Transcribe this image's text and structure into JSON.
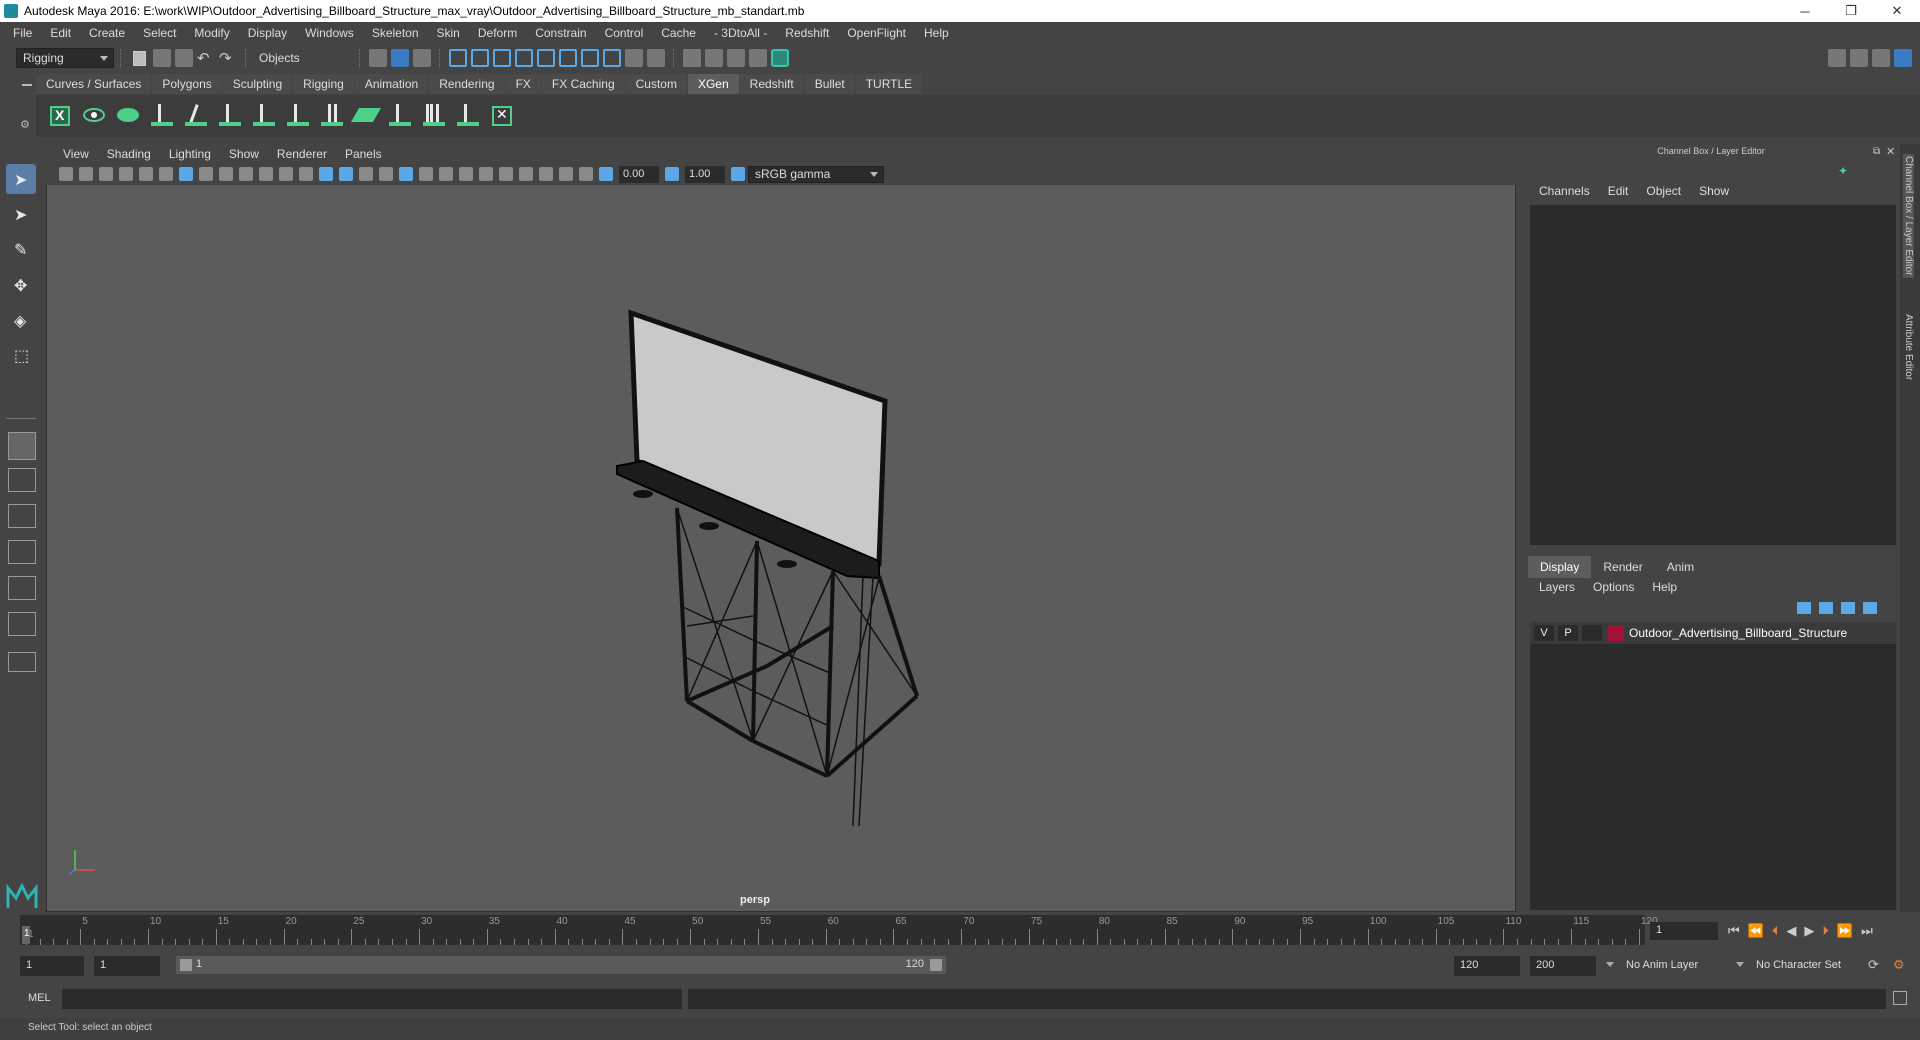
{
  "titlebar": {
    "title": "Autodesk Maya 2016: E:\\work\\WIP\\Outdoor_Advertising_Billboard_Structure_max_vray\\Outdoor_Advertising_Billboard_Structure_mb_standart.mb",
    "minimize": "─",
    "restore": "❐",
    "close": "✕"
  },
  "menubar": [
    "File",
    "Edit",
    "Create",
    "Select",
    "Modify",
    "Display",
    "Windows",
    "Skeleton",
    "Skin",
    "Deform",
    "Constrain",
    "Control",
    "Cache",
    "- 3DtoAll -",
    "Redshift",
    "OpenFlight",
    "Help"
  ],
  "statusline": {
    "menuset": "Rigging",
    "selection_mode": "Objects"
  },
  "shelf": {
    "tabs": [
      "Curves / Surfaces",
      "Polygons",
      "Sculpting",
      "Rigging",
      "Animation",
      "Rendering",
      "FX",
      "FX Caching",
      "Custom",
      "XGen",
      "Redshift",
      "Bullet",
      "TURTLE"
    ],
    "active_tab": "XGen"
  },
  "viewport": {
    "menu": [
      "View",
      "Shading",
      "Lighting",
      "Show",
      "Renderer",
      "Panels"
    ],
    "exposure": "0.00",
    "gamma": "1.00",
    "color_space": "sRGB gamma",
    "camera": "persp"
  },
  "channel_box": {
    "title": "Channel Box / Layer Editor",
    "menu": [
      "Channels",
      "Edit",
      "Object",
      "Show"
    ]
  },
  "layer_editor": {
    "tabs": [
      "Display",
      "Render",
      "Anim"
    ],
    "active_tab": "Display",
    "menu": [
      "Layers",
      "Options",
      "Help"
    ],
    "layer": {
      "visible": "V",
      "playback": "P",
      "name": "Outdoor_Advertising_Billboard_Structure",
      "color": "#a0143c"
    }
  },
  "side_tabs": [
    "Channel Box / Layer Editor",
    "Attribute Editor"
  ],
  "timeline": {
    "ticks": [
      "1",
      "5",
      "10",
      "15",
      "20",
      "25",
      "30",
      "35",
      "40",
      "45",
      "50",
      "55",
      "60",
      "65",
      "70",
      "75",
      "80",
      "85",
      "90",
      "95",
      "100",
      "105",
      "110",
      "115",
      "120"
    ],
    "current_frame": "1"
  },
  "range": {
    "start": "1",
    "playback_start": "1",
    "range_start_label": "1",
    "range_end_label": "120",
    "playback_end": "120",
    "end": "200",
    "anim_layer": "No Anim Layer",
    "character_set": "No Character Set"
  },
  "command_line": {
    "label": "MEL"
  },
  "status_text": "Select Tool: select an object"
}
